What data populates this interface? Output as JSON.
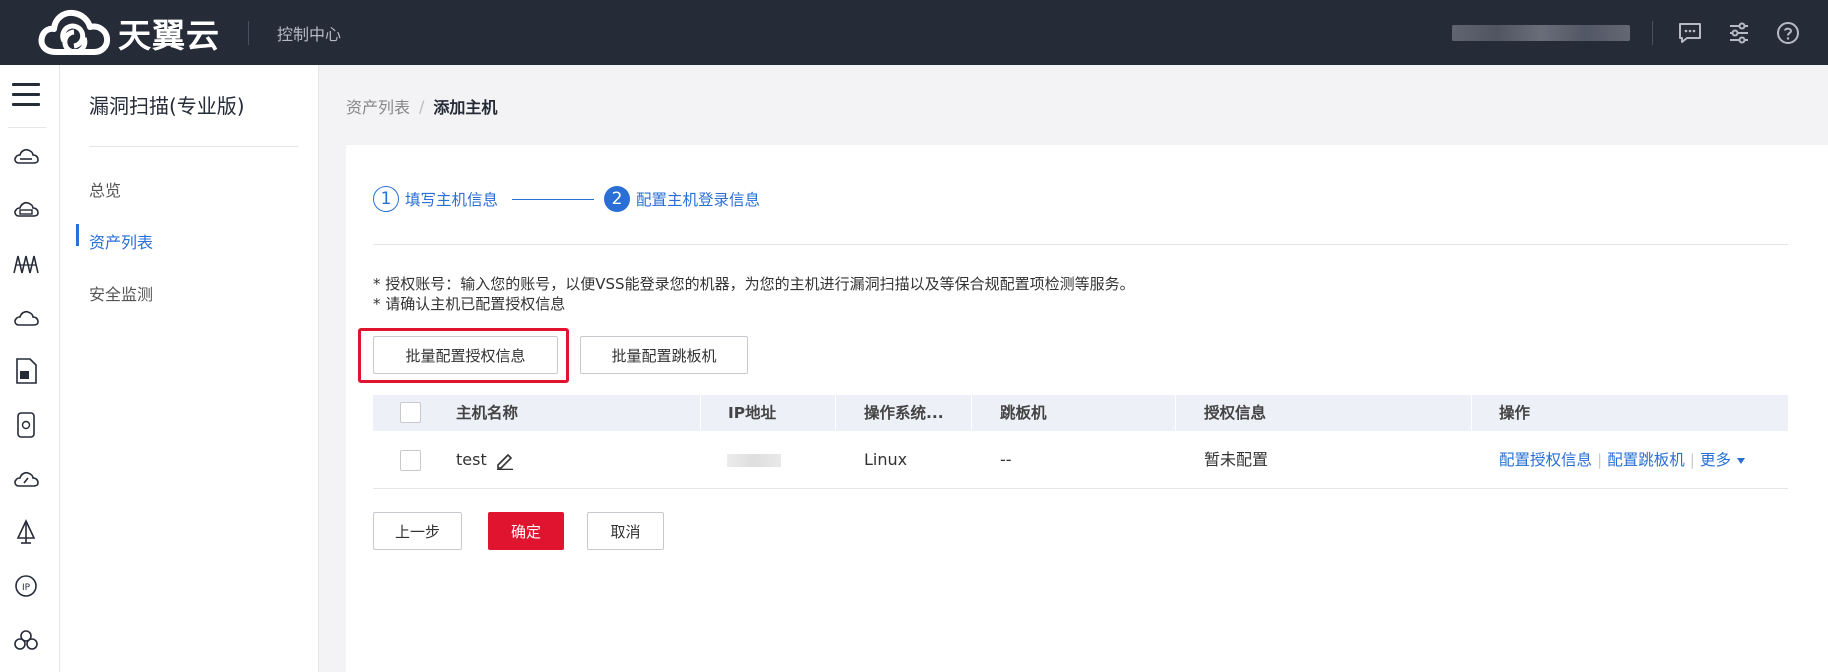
{
  "header": {
    "logo_text": "天翼云",
    "console_label": "控制中心",
    "icons": [
      "message-icon",
      "settings-sliders-icon",
      "help-icon"
    ]
  },
  "rail": {
    "icons": [
      "menu-icon",
      "cloud-server-icon",
      "server-icon",
      "network-icon",
      "cloud-icon",
      "document-icon",
      "storage-icon",
      "cloud-monitor-icon",
      "sail-icon",
      "ip-icon",
      "cluster-icon"
    ]
  },
  "sidebar": {
    "title": "漏洞扫描(专业版)",
    "items": [
      {
        "label": "总览"
      },
      {
        "label": "资产列表",
        "active": true
      },
      {
        "label": "安全监测"
      }
    ]
  },
  "breadcrumb": {
    "parent": "资产列表",
    "separator": "/",
    "current": "添加主机"
  },
  "steps": [
    {
      "number": "1",
      "label": "填写主机信息"
    },
    {
      "number": "2",
      "label": "配置主机登录信息"
    }
  ],
  "notes": [
    "* 授权账号：输入您的账号，以便VSS能登录您的机器，为您的主机进行漏洞扫描以及等保合规配置项检测等服务。",
    "* 请确认主机已配置授权信息"
  ],
  "actions": {
    "batch_auth": "批量配置授权信息",
    "batch_jump": "批量配置跳板机"
  },
  "table": {
    "headers": [
      "主机名称",
      "IP地址",
      "操作系统...",
      "跳板机",
      "授权信息",
      "操作"
    ],
    "rows": [
      {
        "host": "test",
        "ip": "",
        "os": "Linux",
        "jump": "--",
        "auth": "暂未配置",
        "ops": [
          "配置授权信息",
          "配置跳板机",
          "更多"
        ]
      }
    ]
  },
  "footer": {
    "prev": "上一步",
    "confirm": "确定",
    "cancel": "取消"
  },
  "colors": {
    "topbar": "#262b38",
    "accent": "#2a6fd6",
    "primary_button": "#e0142e",
    "table_header": "#eef0f7"
  }
}
